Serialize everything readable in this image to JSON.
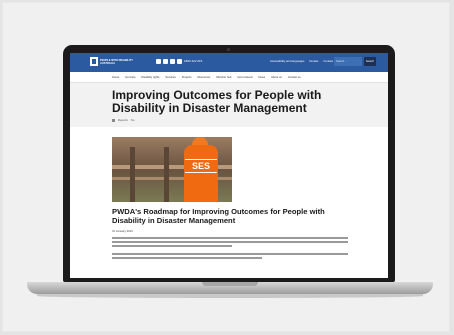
{
  "site": {
    "logo_text": "PEOPLE WITH DISABILITY AUSTRALIA",
    "phone": "1800 422 015",
    "top_links": [
      "Accessibility and languages",
      "Donate",
      "Contact us"
    ],
    "search_placeholder": "Search ...",
    "search_button": "Search"
  },
  "nav": [
    "Home",
    "Get help",
    "Disability rights",
    "Services",
    "Projects",
    "Resources",
    "Member hub",
    "Get involved",
    "News",
    "About us",
    "Contact us"
  ],
  "hero": {
    "title": "Improving Outcomes for People with Disability in Disaster Management",
    "meta": [
      "Reports",
      "No"
    ]
  },
  "article": {
    "image_sign": "SES",
    "title": "PWDA's Roadmap for Improving Outcomes for People with Disability in Disaster Management",
    "date": "31 January 2023"
  }
}
